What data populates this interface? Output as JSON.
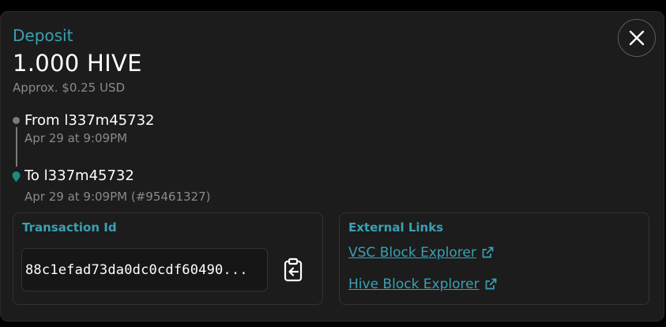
{
  "modal": {
    "title": "Deposit",
    "amount": "1.000 HIVE",
    "approx": "Approx. $0.25 USD"
  },
  "timeline": {
    "from_label": "From l337m45732",
    "from_time": "Apr 29 at 9:09PM",
    "to_label": "To l337m45732",
    "to_time": "Apr 29 at 9:09PM (#95461327)"
  },
  "transaction": {
    "heading": "Transaction Id",
    "id": "88c1efad73da0dc0cdf60490..."
  },
  "external_links": {
    "heading": "External Links",
    "items": [
      {
        "label": "VSC Block Explorer"
      },
      {
        "label": "Hive Block Explorer"
      }
    ]
  },
  "colors": {
    "accent": "#3aa0b3",
    "background": "#1c1c1c",
    "text_primary": "#ffffff",
    "text_secondary": "#8a8a8a"
  },
  "icons": [
    "close-icon",
    "timeline-dot-icon",
    "location-pin-icon",
    "clipboard-copy-icon",
    "external-link-icon"
  ]
}
